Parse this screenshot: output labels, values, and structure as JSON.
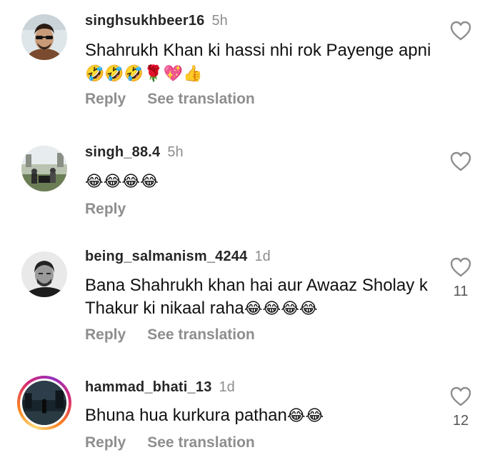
{
  "colors": {
    "text": "#111111",
    "muted": "#8e8e8e",
    "username": "#262626"
  },
  "comments": [
    {
      "username": "singhsukhbeer16",
      "time": "5h",
      "text": "Shahrukh Khan ki hassi nhi rok Payenge apni",
      "emoji": "🤣🤣🤣🌹💖👍",
      "reply": "Reply",
      "translate": "See translation",
      "likes": "",
      "avatar_icon": "profile-photo-man-sunglasses"
    },
    {
      "username": "singh_88.4",
      "time": "5h",
      "text": "",
      "emoji": "😂😂😂😂",
      "reply": "Reply",
      "translate": "",
      "likes": "",
      "avatar_icon": "profile-photo-outdoor-crowd"
    },
    {
      "username": "being_salmanism_4244",
      "time": "1d",
      "text": "Bana Shahrukh khan hai aur Awaaz Sholay k Thakur ki nikaal raha",
      "emoji": "😂😂😂😂",
      "reply": "Reply",
      "translate": "See translation",
      "likes": "11",
      "avatar_icon": "profile-photo-bw-man"
    },
    {
      "username": "hammad_bhati_13",
      "time": "1d",
      "text": "Bhuna hua kurkura pathan",
      "emoji": "😂😂",
      "reply": "Reply",
      "translate": "See translation",
      "likes": "12",
      "avatar_icon": "profile-photo-night-scene-with-story-ring"
    }
  ]
}
